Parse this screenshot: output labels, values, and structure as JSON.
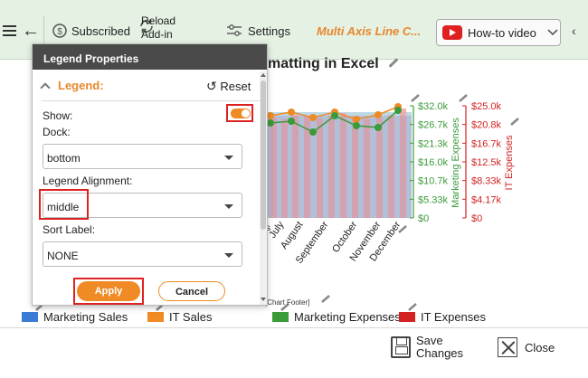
{
  "toolbar": {
    "subscribed": "Subscribed",
    "reload": "Reload Add-in",
    "settings": "Settings",
    "title": "Multi Axis Line C...",
    "howto": "How-to video"
  },
  "chart": {
    "title_visible": "matting in Excel",
    "footer": "[Chart Footer]"
  },
  "chart_data": {
    "type": "line",
    "categories": [
      "July",
      "August",
      "September",
      "October",
      "November",
      "December"
    ],
    "axis_marketing_expenses": {
      "label": "Marketing Expenses",
      "ticks": [
        "$0",
        "$5.33k",
        "$10.7k",
        "$16.0k",
        "$21.3k",
        "$26.7k",
        "$32.0k"
      ],
      "color": "#3a9b3a"
    },
    "axis_it_expenses": {
      "label": "IT Expenses",
      "ticks": [
        "$0",
        "$4.17k",
        "$8.33k",
        "$12.5k",
        "$16.7k",
        "$20.8k",
        "$25.0k"
      ],
      "color": "#d22222"
    },
    "series": [
      {
        "name": "Marketing Sales",
        "color": "#a9cfe0"
      },
      {
        "name": "IT Sales",
        "color": "#f2a7a7"
      },
      {
        "name": "Marketing Expenses",
        "color": "#3a9b3a"
      },
      {
        "name": "IT Expenses",
        "color": "#f08a24"
      }
    ],
    "legend_position": "bottom"
  },
  "legend": {
    "items": [
      {
        "label": "Marketing Sales",
        "color": "#3a7bd5"
      },
      {
        "label": "IT Sales",
        "color": "#f08a24"
      },
      {
        "label": "Marketing Expenses",
        "color": "#3a9b3a"
      },
      {
        "label": "IT Expenses",
        "color": "#d22222"
      }
    ]
  },
  "panel": {
    "title": "Legend Properties",
    "section": "Legend:",
    "reset": "Reset",
    "show_label": "Show:",
    "show_value": true,
    "dock_label": "Dock:",
    "dock_value": "bottom",
    "alignment_label": "Legend Alignment:",
    "alignment_value": "middle",
    "sort_label": "Sort Label:",
    "sort_value": "NONE",
    "apply": "Apply",
    "cancel": "Cancel"
  },
  "footer": {
    "save": "Save Changes",
    "close": "Close"
  }
}
